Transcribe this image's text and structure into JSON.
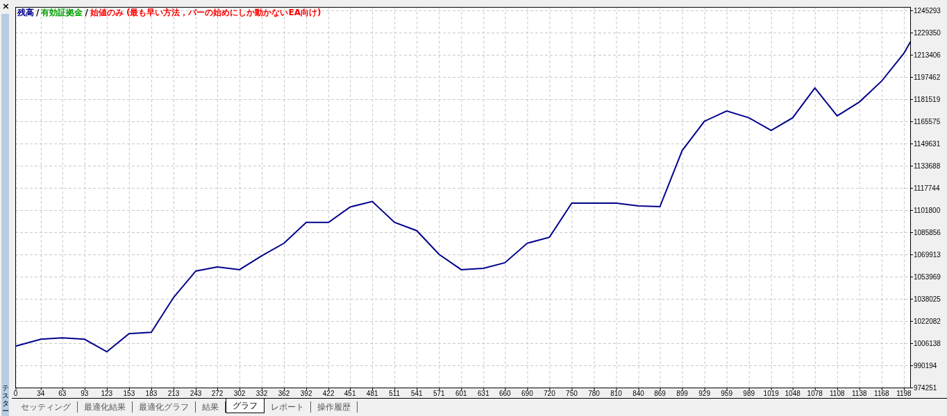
{
  "side_panel": {
    "close": "×",
    "title": "テスター"
  },
  "chart": {
    "legend_extra": [
      {
        "label": "有効証拠金",
        "color": "#00a000"
      },
      {
        "label": "始値のみ (最も早い方法，バーの始めにしか動かないEA向け)",
        "color": "#ff0000"
      }
    ],
    "legend_separator": "/",
    "chart_data": {
      "type": "line",
      "grid": true,
      "x": [
        0,
        34,
        63,
        93,
        123,
        153,
        183,
        213,
        243,
        272,
        302,
        332,
        362,
        392,
        422,
        451,
        481,
        511,
        541,
        571,
        601,
        631,
        660,
        690,
        720,
        750,
        780,
        810,
        840,
        869,
        899,
        929,
        959,
        989,
        1019,
        1048,
        1078,
        1108,
        1138,
        1168,
        1198,
        1207
      ],
      "series": [
        {
          "name": "残高",
          "color": "#00008b",
          "values": [
            1004000,
            1009000,
            1010000,
            1009000,
            1000000,
            1013000,
            1014000,
            1039000,
            1058000,
            1061000,
            1059000,
            1069000,
            1078000,
            1093000,
            1093000,
            1104000,
            1108000,
            1093000,
            1087000,
            1070000,
            1059000,
            1060000,
            1064000,
            1078000,
            1082300,
            1106800,
            1106800,
            1106800,
            1104800,
            1104300,
            1144600,
            1165600,
            1173000,
            1168100,
            1159100,
            1168100,
            1189500,
            1169500,
            1179500,
            1194500,
            1214400,
            1222900
          ]
        }
      ],
      "xlim": [
        0,
        1207
      ],
      "ylim": [
        974251,
        1245293
      ],
      "xticks": [
        0,
        34,
        63,
        93,
        123,
        153,
        183,
        213,
        243,
        272,
        302,
        332,
        362,
        392,
        422,
        451,
        481,
        511,
        541,
        571,
        601,
        631,
        660,
        690,
        720,
        750,
        780,
        810,
        840,
        869,
        899,
        929,
        959,
        989,
        1019,
        1048,
        1078,
        1108,
        1138,
        1168,
        1198
      ],
      "yticks": [
        974251,
        990194,
        1006138,
        1022082,
        1038025,
        1053969,
        1069913,
        1085856,
        1101800,
        1117744,
        1133688,
        1149631,
        1165575,
        1181519,
        1197462,
        1213406,
        1229350,
        1245293
      ]
    }
  },
  "tabs": [
    {
      "label": "セッティング",
      "selected": false
    },
    {
      "label": "最適化結果",
      "selected": false
    },
    {
      "label": "最適化グラフ",
      "selected": false
    },
    {
      "label": "結果",
      "selected": false
    },
    {
      "label": "グラフ",
      "selected": true
    },
    {
      "label": "レポート",
      "selected": false
    },
    {
      "label": "操作履歴",
      "selected": false
    }
  ]
}
